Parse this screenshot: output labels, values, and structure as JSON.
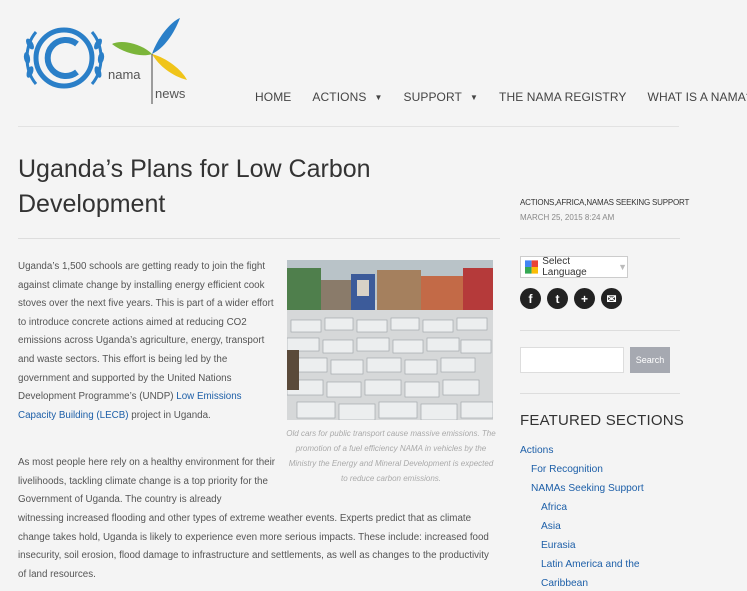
{
  "header": {
    "logo": {
      "text_nama": "nama",
      "text_news": "news"
    },
    "nav": [
      {
        "label": "HOME",
        "has_dropdown": false
      },
      {
        "label": "ACTIONS",
        "has_dropdown": true
      },
      {
        "label": "SUPPORT",
        "has_dropdown": true
      },
      {
        "label": "THE NAMA REGISTRY",
        "has_dropdown": false
      },
      {
        "label": "WHAT IS A NAMA?",
        "has_dropdown": false
      }
    ]
  },
  "article": {
    "title": "Uganda’s Plans for Low Carbon Development",
    "p1_text": "Uganda’s 1,500 schools are getting ready to join the fight against climate change by installing energy efficient cook stoves over the next five years. This is part of a wider effort to introduce concrete actions aimed at reducing CO2 emissions across Uganda’s agriculture, energy, transport and waste sectors. This effort is being led by the government and supported by the United Nations Development Programme’s (UNDP) ",
    "p1_link": "Low Emissions Capacity Building (LECB)",
    "p1_tail": " project in Uganda.",
    "p2": "As most people here rely on a healthy environment for their livelihoods, tackling climate change is a top priority for the Government of Uganda. The country is already",
    "p3": "witnessing increased flooding and other types of extreme weather events. Experts predict that as climate change takes hold, Uganda is likely to experience even more serious impacts. These include: increased food insecurity, soil erosion, flood damage to infrastructure and settlements, as well as changes to the productivity of land resources.",
    "caption": "Old cars for public transport cause massive emissions. The promotion of a fuel efficiency NAMA in vehicles by the Ministry the Energy and Mineral Development is expected to reduce carbon emissions."
  },
  "sidebar": {
    "categories": "ACTIONS,AFRICA,NAMAS SEEKING SUPPORT",
    "date": "MARCH 25, 2015 8:24 AM",
    "translate_label": "Select Language",
    "translate_arrow": "▼",
    "social": [
      {
        "icon": "facebook-icon",
        "glyph": "f"
      },
      {
        "icon": "twitter-icon",
        "glyph": "t"
      },
      {
        "icon": "googleplus-icon",
        "glyph": "+"
      },
      {
        "icon": "email-icon",
        "glyph": "✉"
      }
    ],
    "search_placeholder": "",
    "search_button": "Search",
    "featured_title": "FEATURED SECTIONS",
    "featured": [
      {
        "label": "Actions",
        "level": 1
      },
      {
        "label": "For Recognition",
        "level": 2
      },
      {
        "label": "NAMAs Seeking Support",
        "level": 2
      },
      {
        "label": "Africa",
        "level": 3
      },
      {
        "label": "Asia",
        "level": 3
      },
      {
        "label": "Eurasia",
        "level": 3
      },
      {
        "label": "Latin America and the",
        "level": 3
      },
      {
        "label": "Caribbean",
        "level": 3
      }
    ]
  },
  "colors": {
    "link": "#1d5fa8",
    "logo_blue": "#2a7fc8",
    "logo_green": "#7bb53a",
    "logo_yellow": "#f0c419"
  }
}
